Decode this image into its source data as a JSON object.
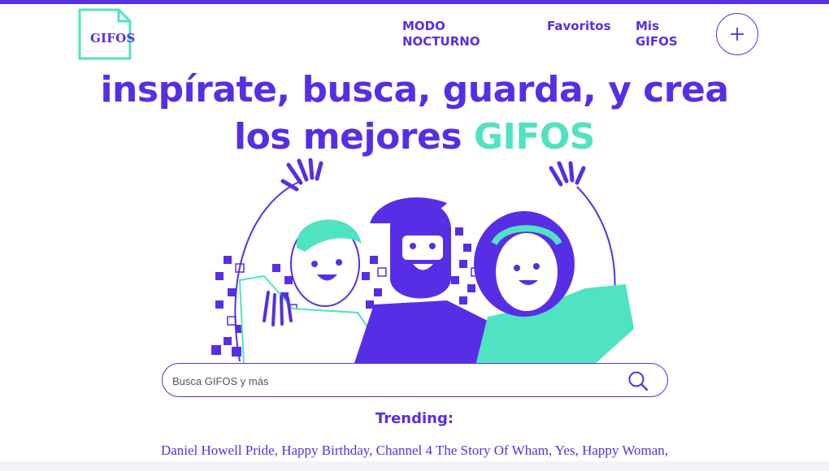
{
  "logo": {
    "text": "GIFOS"
  },
  "nav": {
    "night_mode": "MODO NOCTURNO",
    "favorites": "Favoritos",
    "my_gifos": "Mis GIFOS",
    "create_icon": "plus-icon"
  },
  "hero": {
    "line1": "inspírate, busca, guarda, y crea",
    "line2_prefix": "los mejores ",
    "line2_accent": "GIFOS"
  },
  "search": {
    "placeholder": "Busca GIFOS y más",
    "value": "",
    "icon": "search-icon"
  },
  "trending": {
    "title": "Trending:",
    "items": [
      "Daniel Howell Pride",
      "Happy Birthday",
      "Channel 4 The Story Of Wham",
      "Yes",
      "Happy Woman"
    ]
  },
  "colors": {
    "primary": "#572EE5",
    "accent": "#50E3C2",
    "background": "#FFFFFF"
  }
}
